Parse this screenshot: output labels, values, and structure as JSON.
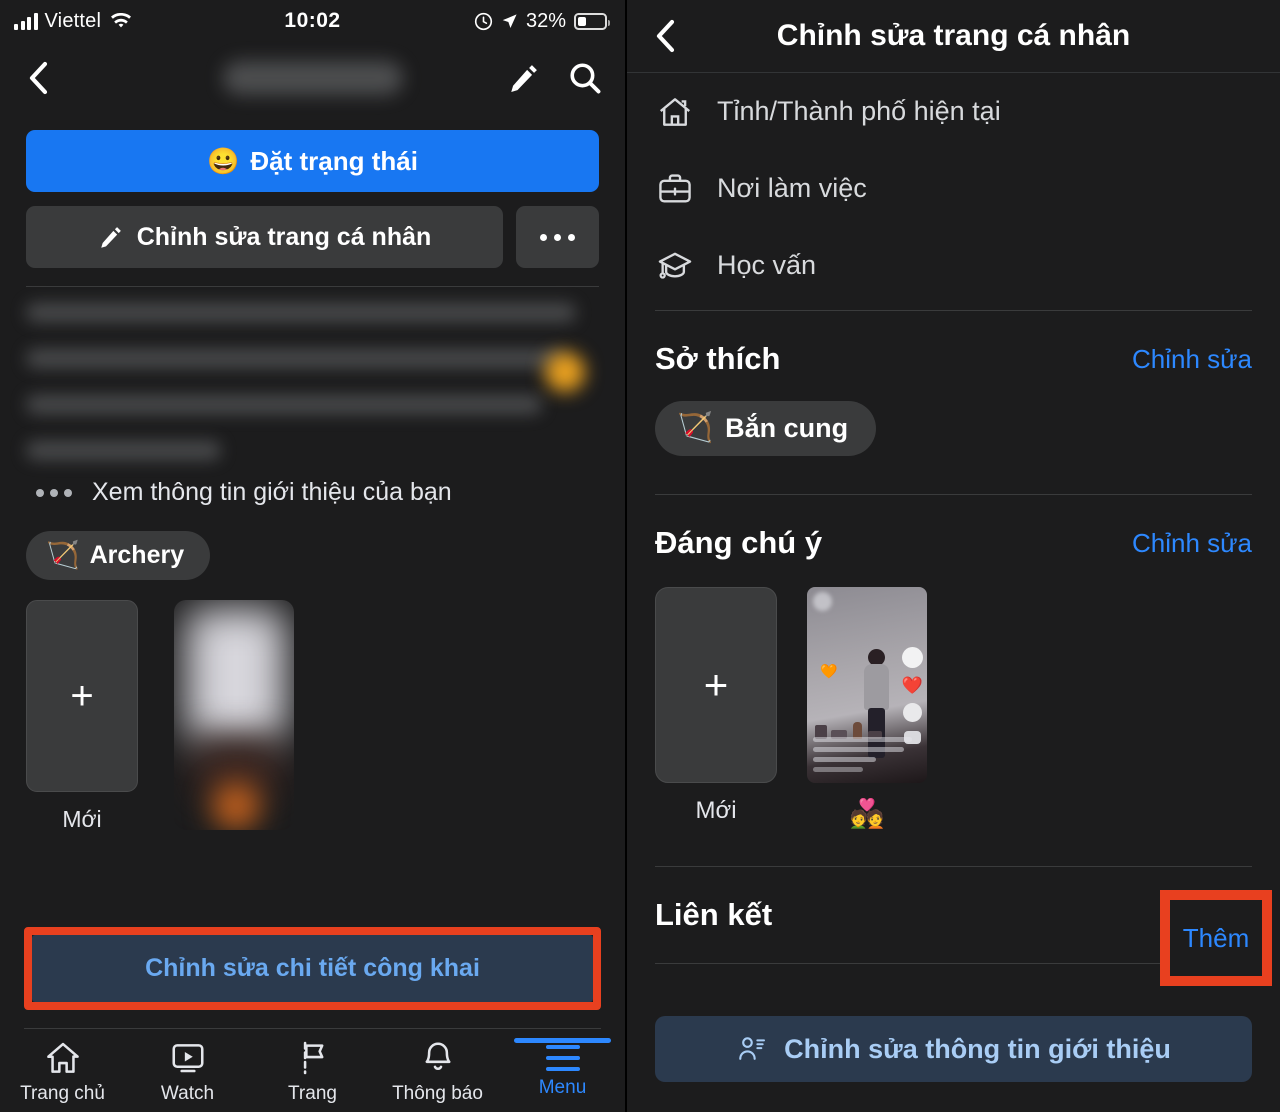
{
  "status_bar": {
    "carrier": "Viettel",
    "time": "10:02",
    "battery_percent": "32%",
    "wifi_icon": "wifi-icon",
    "signal_icon": "cellular-signal-icon",
    "lock_icon": "rotation-lock-icon",
    "location_icon": "location-arrow-icon",
    "battery_icon": "battery-icon"
  },
  "left_panel": {
    "header": {
      "back_icon": "chevron-left-icon",
      "title_redacted": "",
      "edit_icon": "pencil-icon",
      "search_icon": "search-icon"
    },
    "status_button": {
      "label": "Đặt trạng thái",
      "emoji": "😀"
    },
    "edit_profile_button": {
      "label": "Chỉnh sửa trang cá nhân",
      "icon": "pencil-icon"
    },
    "more_button": {
      "icon": "ellipsis-icon"
    },
    "about_row": {
      "label": "Xem thông tin giới thiệu của bạn",
      "icon": "ellipsis-icon"
    },
    "hobby_chip": {
      "label": "Archery",
      "emoji": "🏹"
    },
    "featured": {
      "new_card_label": "Mới",
      "plus_icon": "plus-icon"
    },
    "public_details_button": {
      "label": "Chỉnh sửa chi tiết công khai"
    },
    "highlight_color": "#e8401f",
    "tabbar": [
      {
        "label": "Trang chủ",
        "icon": "home-icon",
        "active": false
      },
      {
        "label": "Watch",
        "icon": "video-play-icon",
        "active": false
      },
      {
        "label": "Trang",
        "icon": "flag-icon",
        "active": false
      },
      {
        "label": "Thông báo",
        "icon": "bell-icon",
        "active": false
      },
      {
        "label": "Menu",
        "icon": "hamburger-menu-icon",
        "active": true
      }
    ]
  },
  "right_panel": {
    "header": {
      "title": "Chỉnh sửa trang cá nhân",
      "back_icon": "chevron-left-icon"
    },
    "menu_items": [
      {
        "label": "Tỉnh/Thành phố hiện tại",
        "icon": "home-icon"
      },
      {
        "label": "Nơi làm việc",
        "icon": "briefcase-icon"
      },
      {
        "label": "Học vấn",
        "icon": "graduation-cap-icon"
      }
    ],
    "hobbies_section": {
      "title": "Sở thích",
      "action": "Chỉnh sửa",
      "chip": {
        "label": "Bắn cung",
        "emoji": "🏹"
      }
    },
    "featured_section": {
      "title": "Đáng chú ý",
      "action": "Chỉnh sửa",
      "new_card_label": "Mới",
      "plus_icon": "plus-icon",
      "item_caption": "💑"
    },
    "links_section": {
      "title": "Liên kết",
      "action": "Thêm",
      "highlight_color": "#e8401f"
    },
    "intro_button": {
      "label": "Chỉnh sửa thông tin giới thiệu",
      "icon": "person-details-icon"
    }
  },
  "colors": {
    "accent_blue": "#1877F2",
    "link_blue": "#2d88ff",
    "background": "#1c1c1d",
    "surface": "#3a3b3c",
    "highlight_red": "#e8401f"
  }
}
